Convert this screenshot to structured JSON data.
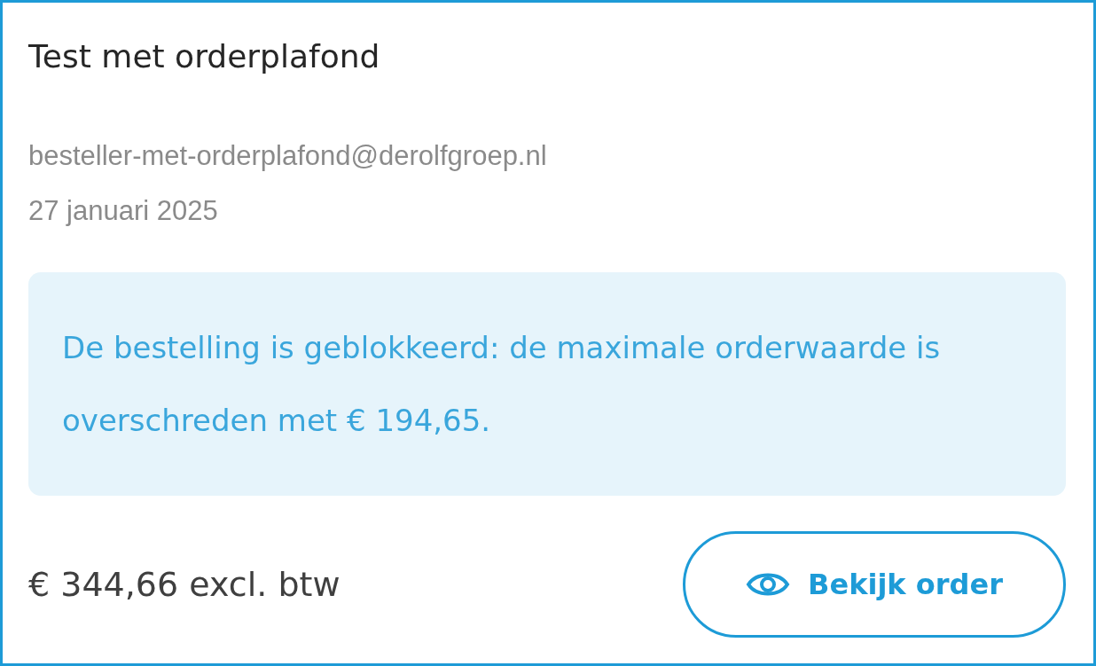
{
  "card": {
    "title": "Test met orderplafond",
    "email": "besteller-met-orderplafond@derolfgroep.nl",
    "date": "27 januari 2025"
  },
  "notice": {
    "text": "De bestelling is geblokkeerd: de maximale orderwaarde is overschreden met € 194,65."
  },
  "footer": {
    "price": "€ 344,66 excl. btw",
    "button": "Bekijk order"
  }
}
